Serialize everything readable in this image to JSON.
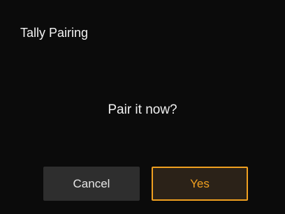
{
  "dialog": {
    "title": "Tally Pairing",
    "message": "Pair it now?",
    "buttons": {
      "cancel_label": "Cancel",
      "yes_label": "Yes"
    }
  },
  "colors": {
    "background": "#0b0b0b",
    "accent": "#f0a020",
    "cancel_button_bg": "#2e2e2e"
  }
}
